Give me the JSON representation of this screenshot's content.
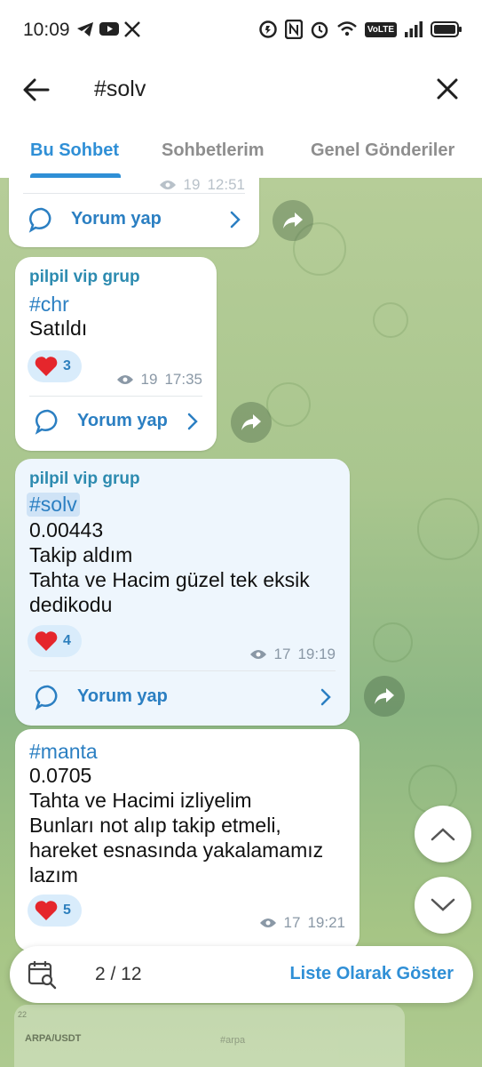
{
  "status_bar": {
    "time": "10:09",
    "left_icons": [
      "telegram-icon",
      "youtube-icon",
      "x-icon"
    ],
    "right_icons": [
      "data-saver-icon",
      "nfc-icon",
      "alarm-icon",
      "wifi-icon",
      "volte-icon",
      "signal-icon",
      "battery-icon"
    ],
    "volte_label": "VoLTE"
  },
  "top_bar": {
    "search_query": "#solv"
  },
  "tabs": [
    {
      "label": "Bu Sohbet",
      "active": true
    },
    {
      "label": "Sohbetlerim",
      "active": false
    },
    {
      "label": "Genel Gönderiler",
      "active": false
    }
  ],
  "messages": [
    {
      "id": "partial",
      "meta_views": "19",
      "meta_time": "12:51",
      "comment_label": "Yorum yap"
    },
    {
      "id": "chr",
      "sender": "pilpil vip grup",
      "hashtag": "#chr",
      "lines": [
        "Satıldı"
      ],
      "reaction_count": "3",
      "views": "19",
      "time": "17:35",
      "comment_label": "Yorum yap"
    },
    {
      "id": "solv",
      "sender": "pilpil vip grup",
      "hashtag": "#solv",
      "lines": [
        "0.00443",
        "Takip aldım",
        "Tahta ve Hacim güzel tek eksik",
        "dedikodu"
      ],
      "reaction_count": "4",
      "views": "17",
      "time": "19:19",
      "comment_label": "Yorum yap"
    },
    {
      "id": "manta",
      "hashtag": "#manta",
      "lines": [
        "0.0705",
        "Tahta ve Hacimi izliyelim",
        "Bunları not alıp  takip etmeli,",
        "hareket esnasında yakalamamız",
        "lazım"
      ],
      "reaction_count": "5",
      "views": "17",
      "time": "19:21"
    }
  ],
  "bottom_bar": {
    "counter": "2 / 12",
    "list_button": "Liste Olarak Göster"
  },
  "preview": {
    "status": "22",
    "pair": "ARPA/USDT",
    "search": "#arpa"
  },
  "colors": {
    "accent": "#2f8fd6",
    "sender": "#2d8bb0",
    "heart": "#e5262c",
    "highlight_bubble": "#eef6fd"
  }
}
